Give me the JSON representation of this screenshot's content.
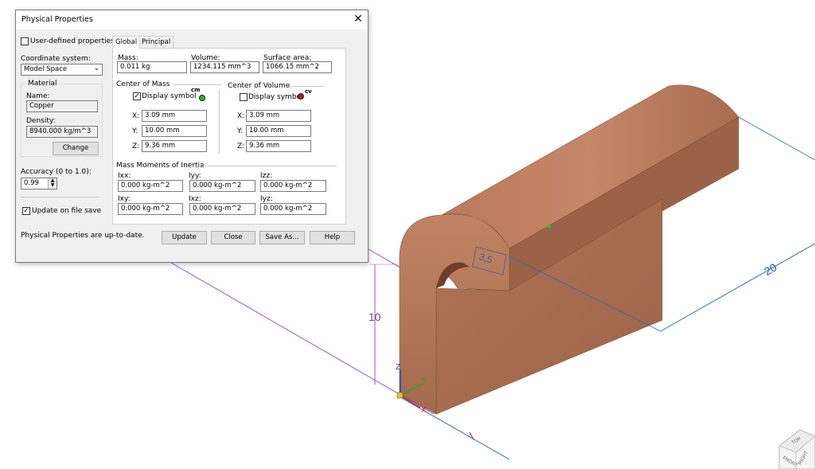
{
  "dialog": {
    "title": "Physical Properties",
    "user_defined": "User-defined properties",
    "coord_label": "Coordinate system:",
    "coord_value": "Model Space",
    "material": {
      "group": "Material",
      "name_label": "Name:",
      "name_value": "Copper",
      "density_label": "Density:",
      "density_value": "8940.000 kg/m^3",
      "change": "Change"
    },
    "accuracy_label": "Accuracy (0 to 1.0):",
    "accuracy_value": "0.99",
    "update_on_save": "Update on file save",
    "status": "Physical Properties are up-to-date.",
    "tabs": [
      "Global",
      "Principal"
    ],
    "mass_label": "Mass:",
    "mass_value": "0.011 kg",
    "volume_label": "Volume:",
    "volume_value": "1234.115 mm^3",
    "area_label": "Surface area:",
    "area_value": "1066.15 mm^2",
    "com": {
      "title": "Center of Mass",
      "display": "Display symbol",
      "sym": "cm",
      "color": "#22b822",
      "x_label": "X:",
      "x": "3.09 mm",
      "y_label": "Y:",
      "y": "10.00 mm",
      "z_label": "Z:",
      "z": "9.36 mm"
    },
    "cov": {
      "title": "Center of Volume",
      "display": "Display symbol",
      "sym": "cv",
      "color": "#c01818",
      "x_label": "X:",
      "x": "3.09 mm",
      "y_label": "Y:",
      "y": "10.00 mm",
      "z_label": "Z:",
      "z": "9.36 mm"
    },
    "inertia": {
      "title": "Mass Moments of Inertia",
      "ixx_label": "Ixx:",
      "ixx": "0.000 kg-m^2",
      "iyy_label": "Iyy:",
      "iyy": "0.000 kg-m^2",
      "izz_label": "Izz:",
      "izz": "0.000 kg-m^2",
      "ixy_label": "Ixy:",
      "ixy": "0.000 kg-m^2",
      "ixz_label": "Ixz:",
      "ixz": "0.000 kg-m^2",
      "iyz_label": "Iyz:",
      "iyz": "0.000 kg-m^2"
    },
    "buttons": {
      "update": "Update",
      "close": "Close",
      "save_as": "Save As...",
      "help": "Help"
    }
  },
  "model": {
    "dim_height": "10",
    "dim_length": "20",
    "dim_radius": "3,5",
    "axis_x": "X",
    "axis_y": "Y",
    "axis_z": "Z",
    "copper_color": "#b7785a",
    "viewcube_top": "TOP",
    "viewcube_front": "FRONT",
    "viewcube_right": "RIGHT"
  }
}
